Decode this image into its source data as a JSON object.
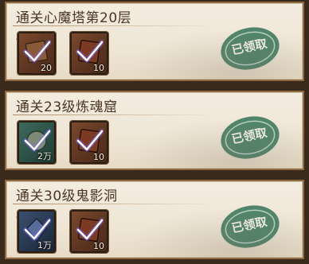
{
  "rewards": [
    {
      "title": "通关心魔塔第20层",
      "items": [
        {
          "qty": "20",
          "color": "#5b3420",
          "icon": "book-icon"
        },
        {
          "qty": "10",
          "color": "#5b3420",
          "icon": "book-icon"
        }
      ],
      "status": "已领取"
    },
    {
      "title": "通关23级炼魂窟",
      "items": [
        {
          "qty": "2万",
          "color": "#2b4e44",
          "icon": "orb-icon"
        },
        {
          "qty": "10",
          "color": "#5b3420",
          "icon": "book-icon"
        }
      ],
      "status": "已领取"
    },
    {
      "title": "通关30级鬼影洞",
      "items": [
        {
          "qty": "1万",
          "color": "#27364c",
          "icon": "crystal-icon"
        },
        {
          "qty": "10",
          "color": "#5b3420",
          "icon": "book-icon"
        }
      ],
      "status": "已领取"
    }
  ],
  "colors": {
    "stamp_green": "#3f7a5e",
    "check_glow": "#6a5cff",
    "panel_bg": "#efe6d6",
    "frame": "#8b6a45"
  }
}
